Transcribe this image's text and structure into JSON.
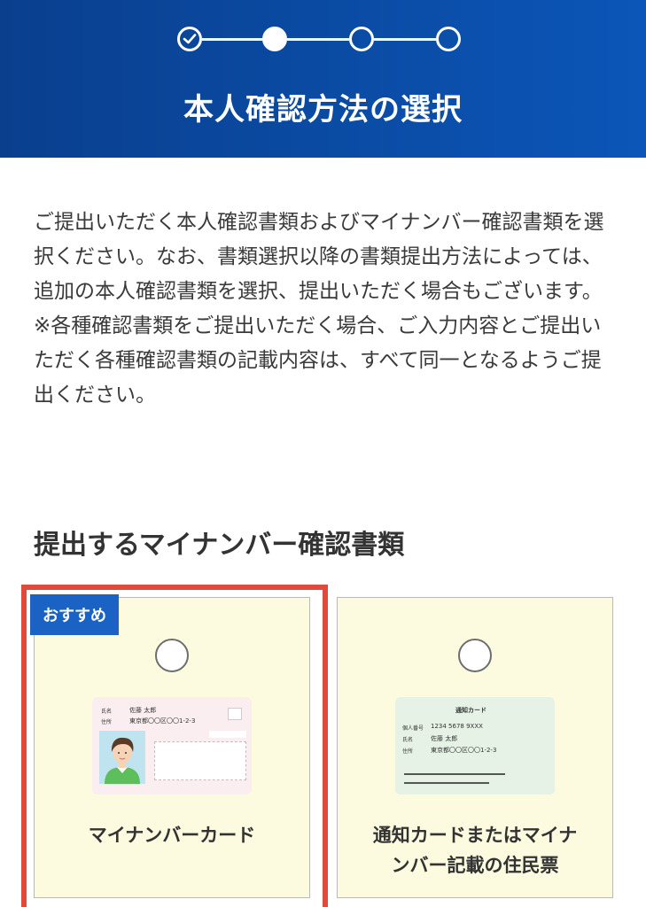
{
  "header": {
    "title": "本人確認方法の選択",
    "steps": [
      "completed",
      "current",
      "upcoming",
      "upcoming"
    ]
  },
  "description": [
    "ご提出いただく本人確認書類およびマイナンバー確認書類を選択ください。なお、書類選択以降の書類提出方法によっては、追加の本人確認書類を選択、提出いただく場合もございます。",
    "※各種確認書類をご提出いただく場合、ご入力内容とご提出いただく各種確認書類の記載内容は、すべて同一となるようご提出ください。"
  ],
  "section": {
    "title": "提出するマイナンバー確認書類"
  },
  "options": [
    {
      "badge": "おすすめ",
      "label": "マイナンバーカード",
      "selected": false,
      "highlighted": true,
      "illustration": {
        "name_label": "氏名",
        "name_value": "佐藤 太郎",
        "address_label": "住所",
        "address_value": "東京都〇〇区〇〇1-2-3"
      }
    },
    {
      "label_line1": "通知カードまたはマイナ",
      "label_line2": "ンバー記載の住民票",
      "selected": false,
      "illustration": {
        "title": "通知カード",
        "number_label": "個人番号",
        "number_value": "1234 5678 9XXX",
        "name_label": "氏名",
        "name_value": "佐藤 太郎",
        "address_label": "住所",
        "address_value": "東京都〇〇区〇〇1-2-3"
      }
    }
  ],
  "colors": {
    "header_blue": "#0b56b8",
    "badge_blue": "#1a63c5",
    "highlight_red": "#e04a3a",
    "card_bg": "#fcfbe0"
  }
}
